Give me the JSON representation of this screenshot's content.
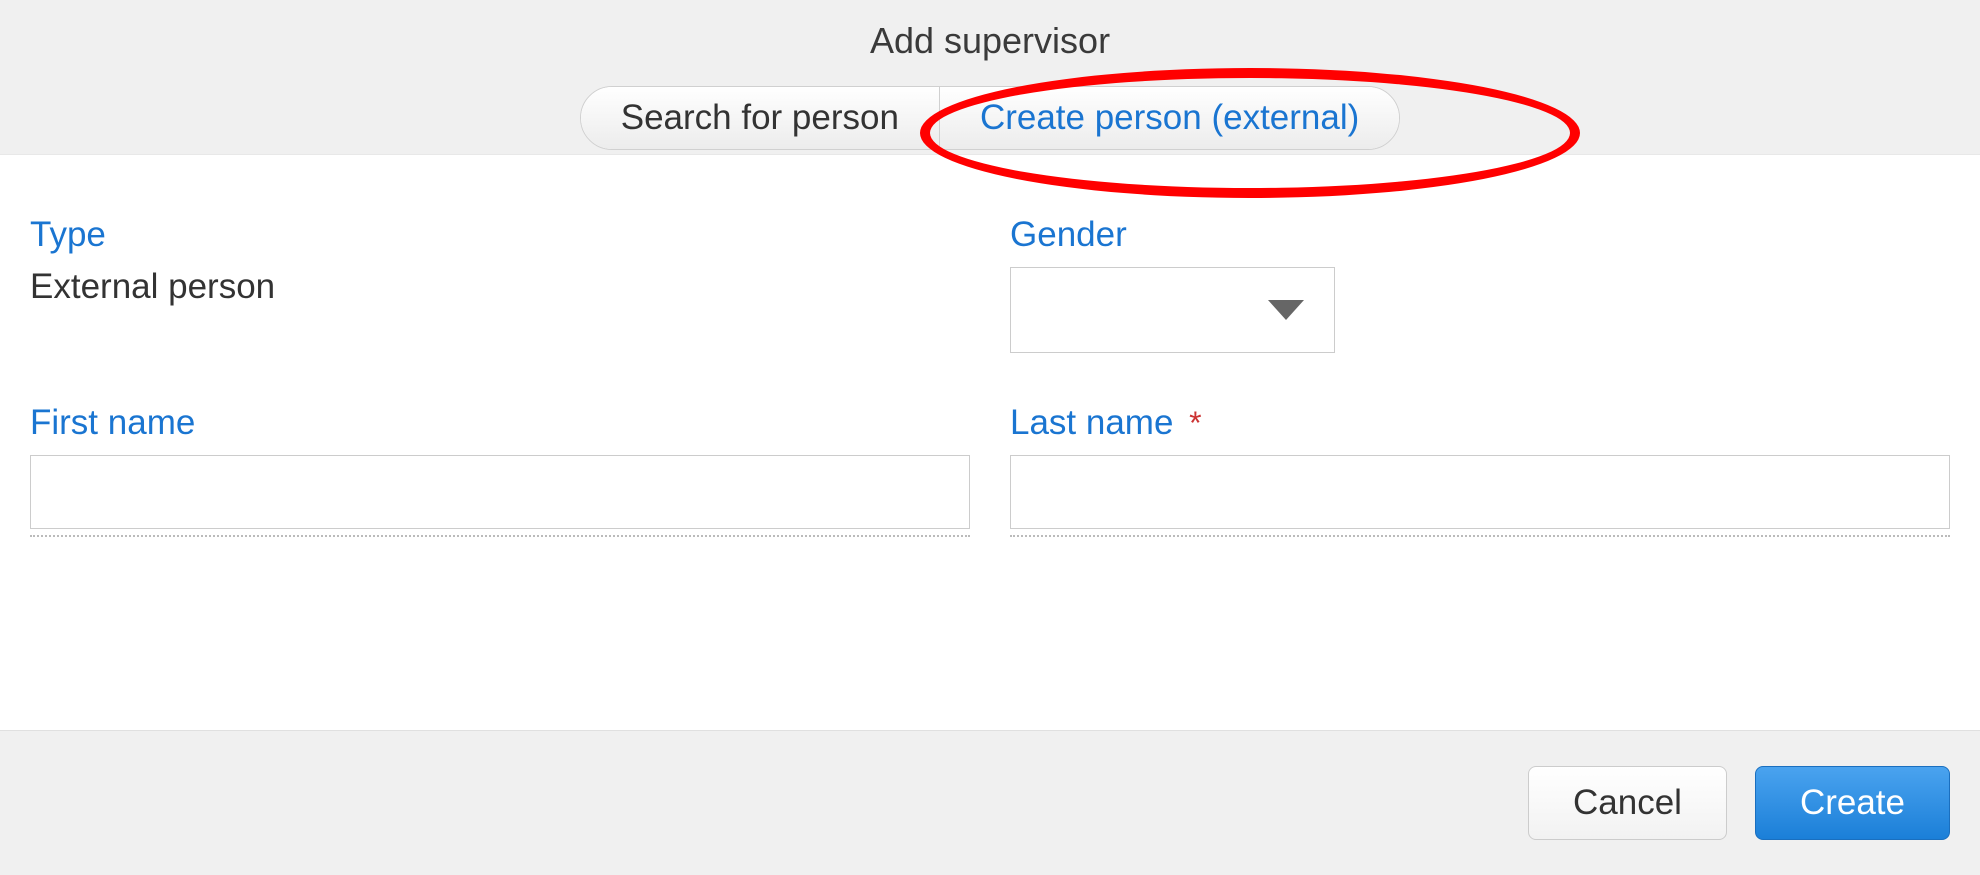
{
  "dialog": {
    "title": "Add supervisor"
  },
  "tabs": {
    "search": "Search for person",
    "create": "Create person (external)"
  },
  "form": {
    "type": {
      "label": "Type",
      "value": "External person"
    },
    "gender": {
      "label": "Gender",
      "value": ""
    },
    "first_name": {
      "label": "First name",
      "value": ""
    },
    "last_name": {
      "label": "Last name",
      "required_mark": "*",
      "value": ""
    }
  },
  "footer": {
    "cancel": "Cancel",
    "create": "Create"
  },
  "annotation": {
    "highlight_target": "tab-create-person-external"
  }
}
